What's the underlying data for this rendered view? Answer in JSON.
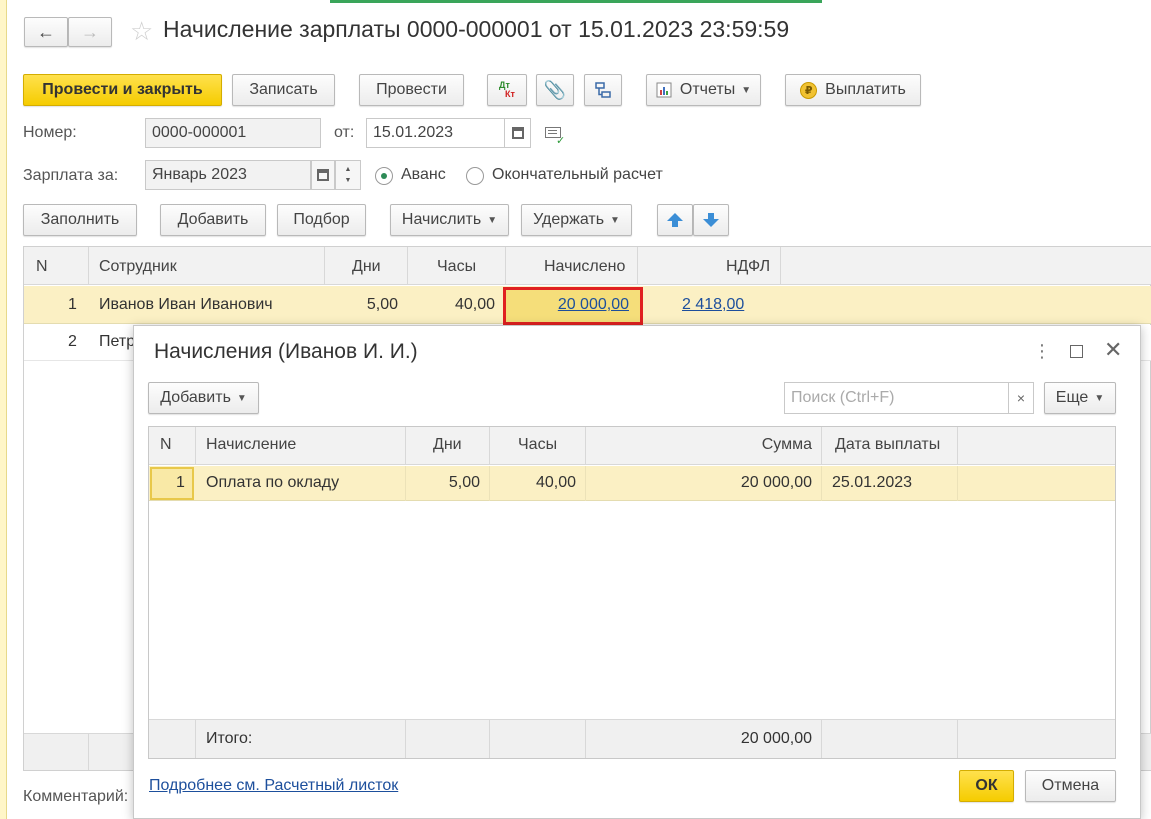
{
  "window": {
    "title": "Начисление зарплаты 0000-000001 от 15.01.2023 23:59:59"
  },
  "toolbar": {
    "post_close": "Провести и закрыть",
    "save": "Записать",
    "post": "Провести",
    "dt_kt_top": "Дт",
    "dt_kt_bottom": "Кт",
    "reports": "Отчеты",
    "pay": "Выплатить"
  },
  "form": {
    "number_label": "Номер:",
    "number_value": "0000-000001",
    "date_label": "от:",
    "date_value": "15.01.2023",
    "salary_for_label": "Зарплата за:",
    "salary_for_value": "Январь 2023",
    "radio_advance": "Аванс",
    "radio_final": "Окончательный расчет",
    "selected_mode": "Аванс",
    "comment_label": "Комментарий:"
  },
  "table_toolbar": {
    "fill": "Заполнить",
    "add": "Добавить",
    "pick": "Подбор",
    "accrue": "Начислить",
    "withhold": "Удержать"
  },
  "main_table": {
    "headers": [
      "N",
      "Сотрудник",
      "Дни",
      "Часы",
      "Начислено",
      "НДФЛ"
    ],
    "rows": [
      {
        "n": "1",
        "employee": "Иванов Иван Иванович",
        "days": "5,00",
        "hours": "40,00",
        "accrued": "20 000,00",
        "ndfl": "2 418,00"
      },
      {
        "n": "2",
        "employee": "Петр"
      }
    ]
  },
  "dialog": {
    "title": "Начисления (Иванов И. И.)",
    "add": "Добавить",
    "search_placeholder": "Поиск (Ctrl+F)",
    "clear": "×",
    "more": "Еще",
    "headers": [
      "N",
      "Начисление",
      "Дни",
      "Часы",
      "Сумма",
      "Дата выплаты"
    ],
    "rows": [
      {
        "n": "1",
        "accrual": "Оплата по окладу",
        "days": "5,00",
        "hours": "40,00",
        "sum": "20 000,00",
        "pay_date": "25.01.2023"
      }
    ],
    "total_label": "Итого:",
    "total_sum": "20 000,00",
    "details_link": "Подробнее см. Расчетный листок",
    "ok": "ОК",
    "cancel": "Отмена"
  },
  "colors": {
    "accent_yellow": "#f5cc00",
    "row_highlight": "#fbf0c4",
    "selection_border": "#e02020",
    "link": "#1d4f9c"
  }
}
